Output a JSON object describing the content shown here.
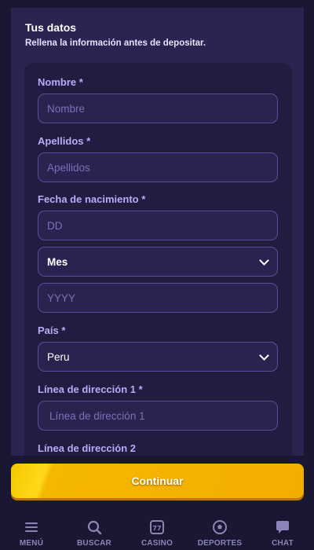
{
  "panel": {
    "title": "Tus datos",
    "subtitle": "Rellena la información antes de depositar."
  },
  "form": {
    "nombre": {
      "label": "Nombre *",
      "placeholder": "Nombre"
    },
    "apellidos": {
      "label": "Apellidos *",
      "placeholder": "Apellidos"
    },
    "fecha": {
      "label": "Fecha de nacimiento *",
      "day_placeholder": "DD",
      "month_value": "Mes",
      "year_placeholder": "YYYY"
    },
    "pais": {
      "label": "País *",
      "value": "Peru"
    },
    "direccion1": {
      "label": "Línea de dirección 1 *",
      "placeholder": "Línea de dirección 1"
    },
    "direccion2": {
      "label": "Línea de dirección 2"
    }
  },
  "cta": {
    "label": "Continuar"
  },
  "nav": {
    "items": [
      {
        "label": "MENÚ",
        "icon": "menu-icon"
      },
      {
        "label": "BUSCAR",
        "icon": "search-icon"
      },
      {
        "label": "CASINO",
        "icon": "slot-machine-icon"
      },
      {
        "label": "DEPORTES",
        "icon": "soccer-ball-icon"
      },
      {
        "label": "CHAT",
        "icon": "chat-icon"
      }
    ]
  },
  "colors": {
    "background": "#1a1733",
    "panel": "#2b2450",
    "card": "#211c40",
    "label": "#b9acf6",
    "cta": "#f3ad00"
  }
}
